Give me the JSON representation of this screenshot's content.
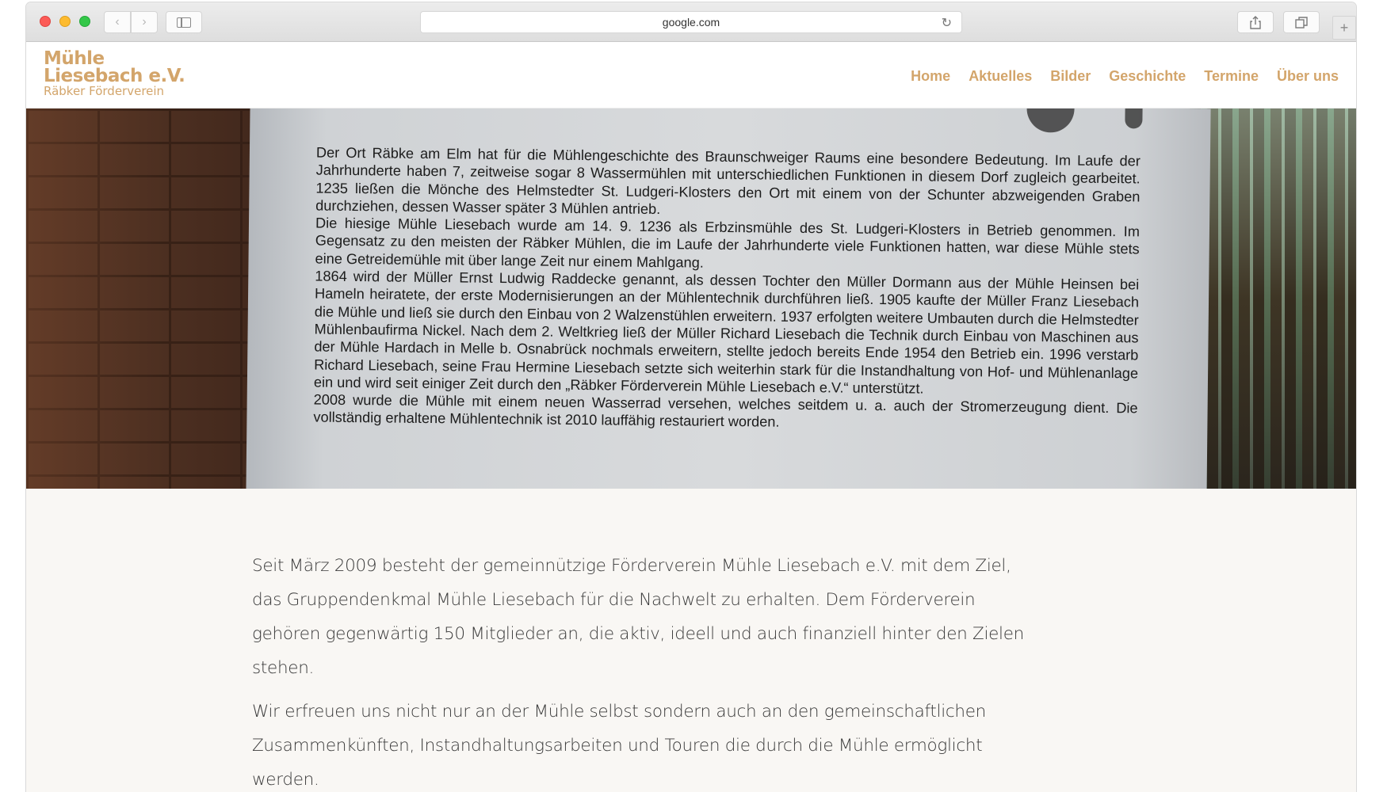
{
  "browser": {
    "url": "google.com"
  },
  "site": {
    "logo": {
      "line1": "Mühle",
      "line2": "Liesebach e.V.",
      "line3": "Räbker Förderverein"
    },
    "nav": [
      "Home",
      "Aktuelles",
      "Bilder",
      "Geschichte",
      "Termine",
      "Über uns"
    ],
    "accent_color": "#d3a56b"
  },
  "hero": {
    "plaque_paragraphs": [
      "Der Ort Räbke am Elm hat für die Mühlengeschichte des Braunschweiger Raums eine besondere Bedeutung. Im Laufe der Jahrhunderte haben 7, zeitweise sogar 8 Wassermühlen mit unterschiedlichen Funktionen in diesem Dorf zugleich gearbeitet. 1235 ließen die Mönche des Helmstedter St. Ludgeri-Klosters den Ort mit einem von der Schunter abzweigenden Graben durchziehen, dessen Wasser später 3 Mühlen antrieb.",
      "Die hiesige Mühle Liesebach wurde am 14. 9. 1236 als Erbzinsmühle des St. Ludgeri-Klosters in Betrieb genommen. Im Gegensatz zu den meisten der Räbker Mühlen, die im Laufe der Jahrhunderte viele Funktionen hatten, war diese Mühle stets eine Getreidemühle mit über lange Zeit nur einem Mahlgang.",
      "1864 wird der Müller Ernst Ludwig Raddecke genannt, als dessen Tochter den Müller Dormann aus der Mühle Heinsen bei Hameln heiratete, der erste Modernisierungen an der Mühlentechnik durchführen ließ. 1905 kaufte der Müller Franz Liesebach die Mühle und ließ sie durch den Einbau von 2 Walzenstühlen erweitern. 1937 erfolgten weitere Umbauten durch die Helmstedter Mühlenbaufirma Nickel. Nach dem 2. Weltkrieg ließ der Müller Richard Liesebach die Technik durch Einbau von Maschinen aus der Mühle Hardach in Melle b. Osnabrück nochmals erweitern, stellte jedoch bereits Ende 1954 den Betrieb ein. 1996 verstarb Richard Liesebach, seine Frau Hermine Liesebach setzte sich weiterhin stark für die Instandhaltung von Hof- und Mühlenanlage ein und wird seit einiger Zeit durch den „Räbker Förderverein Mühle Liesebach e.V.“ unterstützt.",
      "2008 wurde die Mühle mit einem neuen Wasserrad versehen, welches seitdem u. a. auch der Stromerzeugung dient. Die vollständig erhaltene Mühlentechnik ist 2010 lauffähig restauriert worden."
    ]
  },
  "content": {
    "paragraphs": [
      "Seit März 2009 besteht der gemeinnützige Förderverein Mühle Liesebach e.V. mit dem Ziel, das Gruppendenkmal Mühle Liesebach für die Nachwelt zu erhalten. Dem Förderverein gehören gegenwärtig 150 Mitglieder an, die aktiv, ideell und auch finanziell hinter den Zielen stehen.",
      "Wir erfreuen uns nicht nur an der Mühle selbst sondern auch an den gemeinschaftlichen Zusammenkünften, Instandhaltungsarbeiten und Touren die durch die Mühle ermöglicht werden."
    ]
  }
}
